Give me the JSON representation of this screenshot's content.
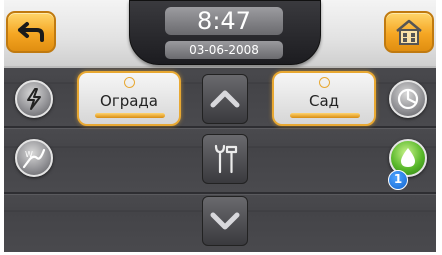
{
  "header": {
    "time": "8:47",
    "date": "03-06-2008"
  },
  "zones": [
    {
      "label": "Ограда"
    },
    {
      "label": "Сад"
    }
  ],
  "notification": {
    "count": "1"
  },
  "icons": {
    "back": "back-arrow-icon",
    "home": "home-icon",
    "power": "lightning-icon",
    "weather": "weather-curve-icon",
    "timer": "pie-clock-icon",
    "water": "water-drop-icon",
    "up": "chevron-up-icon",
    "settings": "tools-icon",
    "down": "chevron-down-icon"
  },
  "colors": {
    "accent_orange": "#f5a623",
    "active_green": "#59b82a",
    "badge_blue": "#1466d0"
  }
}
